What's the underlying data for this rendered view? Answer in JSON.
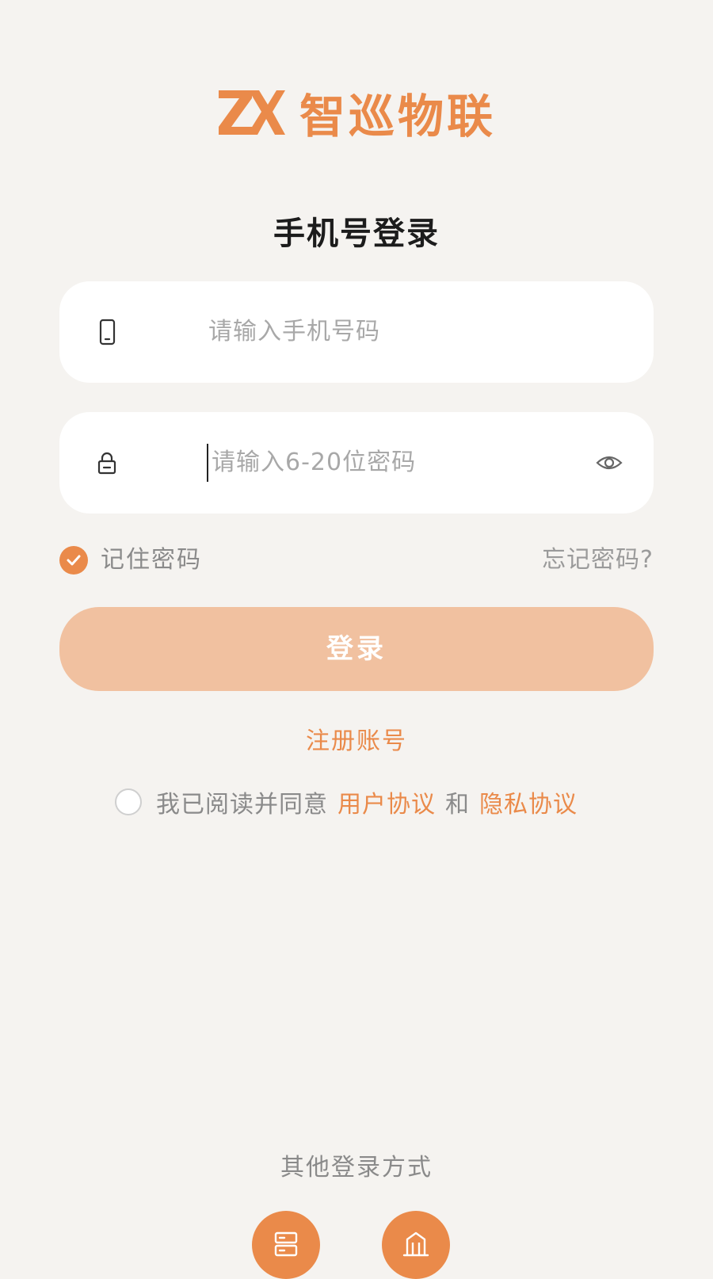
{
  "brand": {
    "mark": "ZX",
    "name": "智巡物联",
    "accent_color": "#ea8a4a"
  },
  "page_title": "手机号登录",
  "phone_field": {
    "icon": "phone-icon",
    "placeholder": "请输入手机号码",
    "value": ""
  },
  "password_field": {
    "icon": "lock-icon",
    "placeholder": "请输入6-20位密码",
    "value": "",
    "visibility_icon": "eye-icon"
  },
  "remember": {
    "label": "记住密码",
    "checked": true
  },
  "forgot_label": "忘记密码?",
  "login_label": "登录",
  "register_label": "注册账号",
  "agreement": {
    "checked": false,
    "prefix": "我已阅读并同意",
    "user_agreement": "用户协议",
    "and": "和",
    "privacy_agreement": "隐私协议"
  },
  "other_login": {
    "label": "其他登录方式",
    "methods": [
      {
        "icon": "server-icon"
      },
      {
        "icon": "building-icon"
      }
    ]
  }
}
